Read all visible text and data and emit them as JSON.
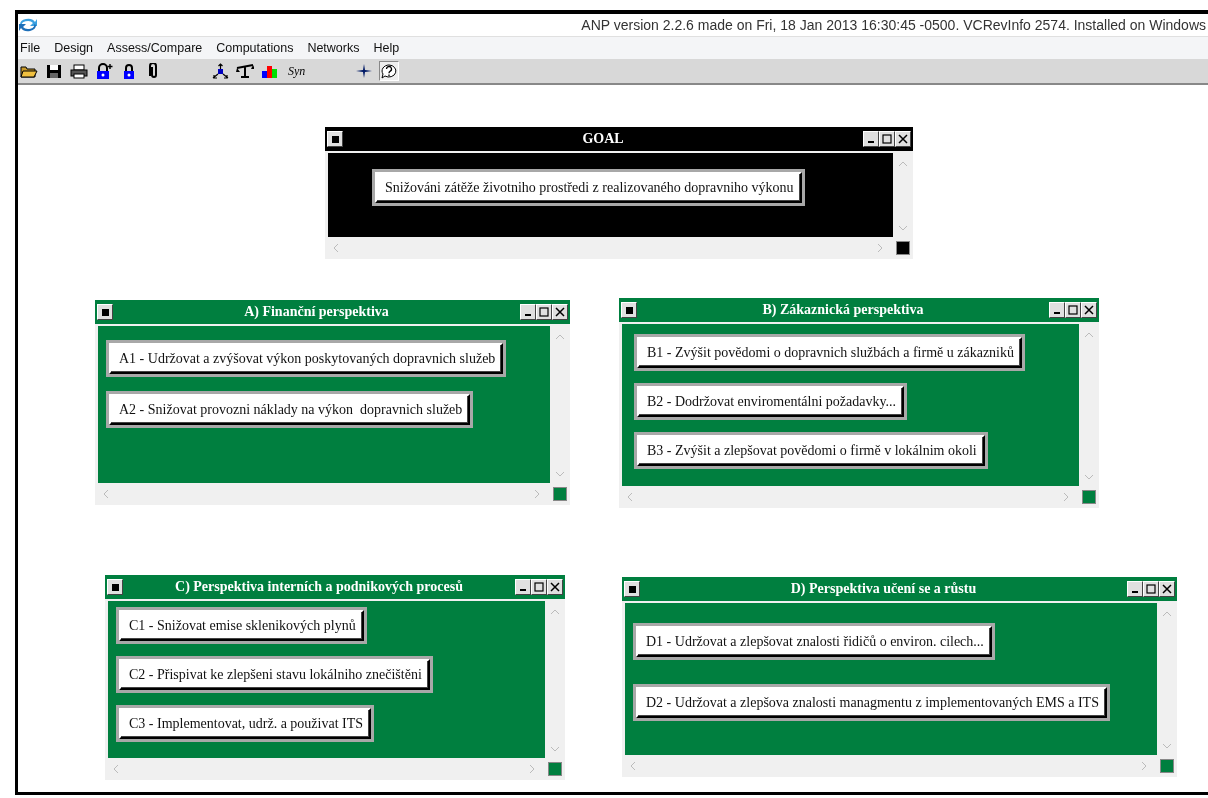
{
  "window": {
    "title": "ANP version 2.2.6 made on Fri, 18 Jan 2013 16:30:45 -0500.  VCRevInfo 2574.  Installed on Windows"
  },
  "menu": [
    "File",
    "Design",
    "Assess/Compare",
    "Computations",
    "Networks",
    "Help"
  ],
  "toolbar": [
    {
      "kind": "open",
      "pressed": false
    },
    {
      "kind": "save",
      "pressed": false
    },
    {
      "kind": "print",
      "pressed": false
    },
    {
      "kind": "lock-add",
      "pressed": false
    },
    {
      "kind": "lock",
      "pressed": false
    },
    {
      "kind": "clip",
      "pressed": false
    },
    {
      "kind": "gap"
    },
    {
      "kind": "nodes",
      "pressed": false
    },
    {
      "kind": "scale",
      "pressed": false
    },
    {
      "kind": "bars",
      "pressed": false
    },
    {
      "kind": "text",
      "label": "Syn",
      "pressed": false
    },
    {
      "kind": "gap"
    },
    {
      "kind": "star",
      "pressed": false
    },
    {
      "kind": "help",
      "pressed": true
    }
  ],
  "clusters": [
    {
      "title": "GOAL",
      "color": "#000000",
      "nodes": [
        "Snižováni zátěže životniho prostředi z realizovaného dopravniho výkonu"
      ]
    },
    {
      "title": "A) Finanční perspektiva",
      "color": "#007f3f",
      "nodes": [
        "A1 - Udržovat a zvýšovat výkon poskytovaných dopravnich služeb",
        "A2 - Snižovat provozni náklady na výkon  dopravnich služeb"
      ]
    },
    {
      "title": "B) Zákaznická perspektiva",
      "color": "#007f3f",
      "nodes": [
        "B1 - Zvýšit povědomi o dopravnich službách a firmě u zákazniků",
        "B2 - Dodržovat enviromentálni požadavky...",
        "B3 - Zvýšit a zlepšovat povědomi o firmě v lokálnim okoli"
      ]
    },
    {
      "title": "C) Perspektiva interních a podnikových procesů",
      "color": "#007f3f",
      "nodes": [
        "C1 - Snižovat emise sklenikových plynů",
        "C2 - Přispivat ke zlepšeni stavu lokálniho znečištěni",
        "C3 - Implementovat, udrž. a použivat ITS"
      ]
    },
    {
      "title": "D) Perspektiva učení se a růstu",
      "color": "#007f3f",
      "nodes": [
        "D1 - Udržovat a zlepšovat znalosti řidičů o environ. cilech...",
        "D2 - Udržovat a zlepšova znalosti managmentu z implementovaných EMS a ITS"
      ]
    }
  ]
}
